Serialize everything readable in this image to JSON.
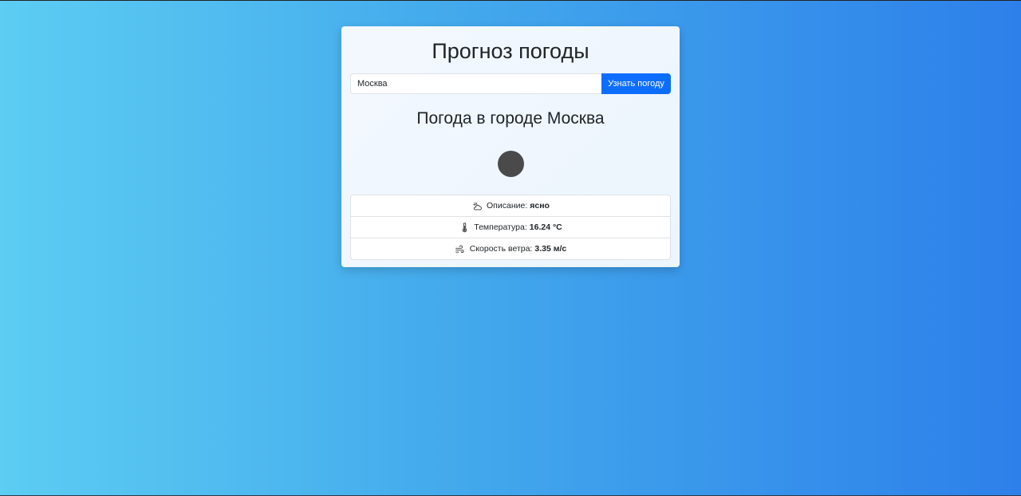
{
  "app": {
    "title": "Прогноз погоды"
  },
  "search": {
    "value": "Москва",
    "button_label": "Узнать погоду"
  },
  "result": {
    "heading": "Погода в городе Москва",
    "icon": "weather-condition-icon",
    "details": [
      {
        "icon": "cloud-sun-icon",
        "label": "Описание:",
        "value": "ясно"
      },
      {
        "icon": "thermometer-icon",
        "label": "Температура:",
        "value": "16.24 °C"
      },
      {
        "icon": "wind-icon",
        "label": "Скорость ветра:",
        "value": "3.35 м/с"
      }
    ]
  },
  "colors": {
    "accent": "#0d6efd",
    "background_start": "#5ccdf3",
    "background_end": "#2d80ea"
  }
}
